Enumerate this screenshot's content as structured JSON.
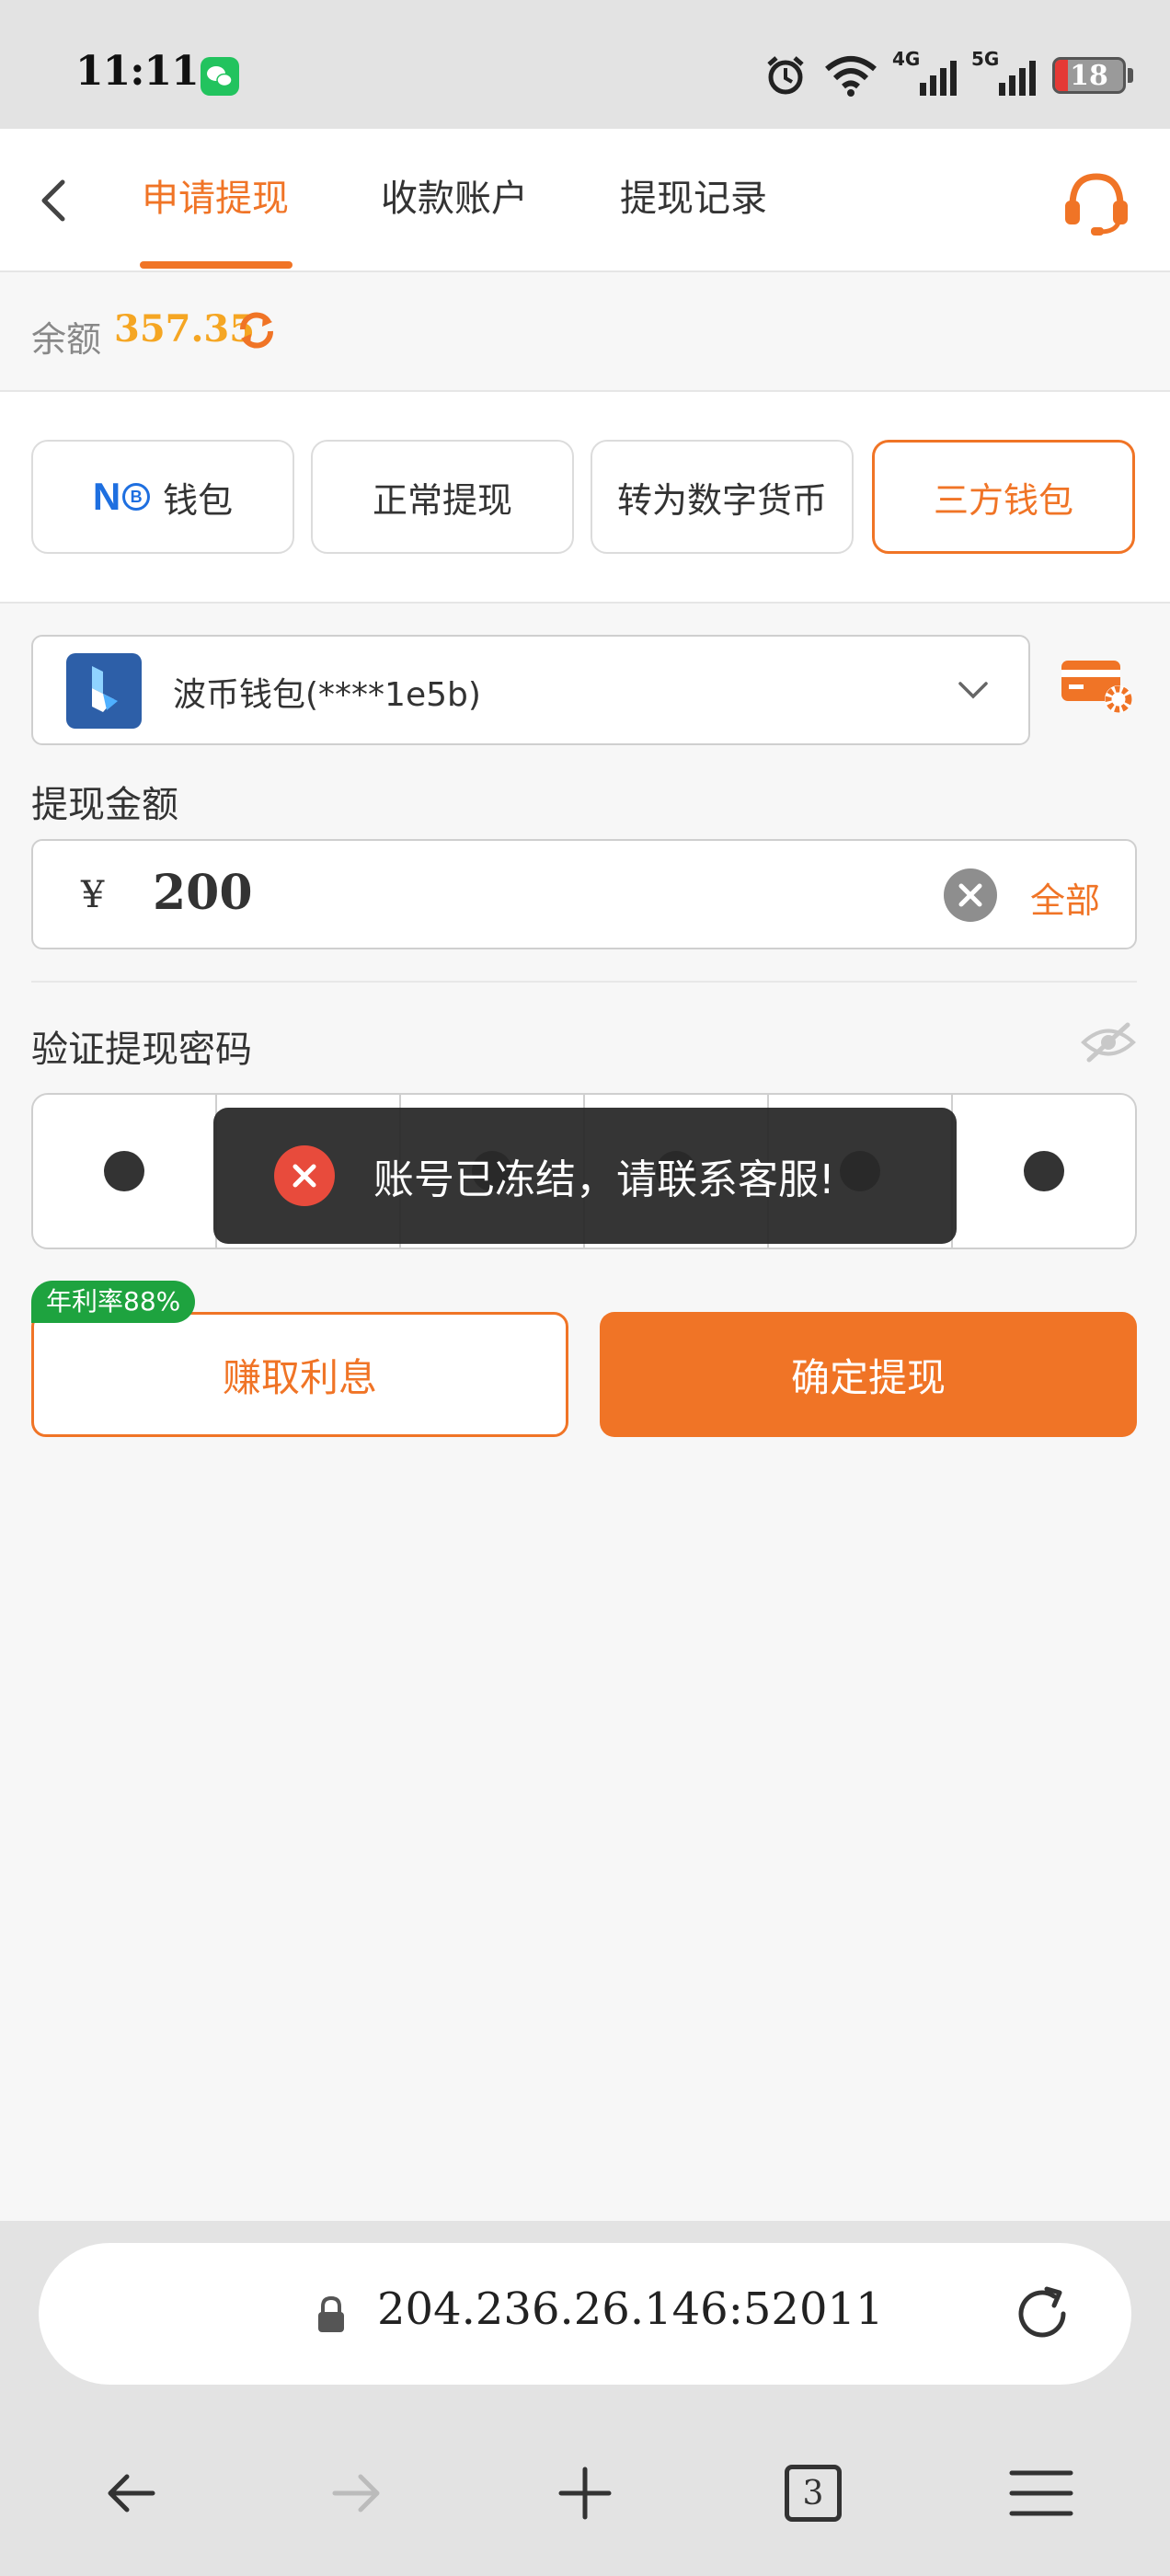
{
  "status_bar": {
    "time": "11:11",
    "network_4g": "4G",
    "network_5g": "5G",
    "battery": "18"
  },
  "nav": {
    "tabs": [
      {
        "label": "申请提现",
        "active": true
      },
      {
        "label": "收款账户",
        "active": false
      },
      {
        "label": "提现记录",
        "active": false
      }
    ]
  },
  "balance": {
    "label": "余额",
    "value": "357.35"
  },
  "methods": [
    {
      "label": "钱包",
      "logo": "NB",
      "active": false
    },
    {
      "label": "正常提现",
      "active": false
    },
    {
      "label": "转为数字货币",
      "active": false
    },
    {
      "label": "三方钱包",
      "active": true
    }
  ],
  "wallet": {
    "selected": "波币钱包(****1e5b)"
  },
  "amount": {
    "title": "提现金额",
    "currency": "¥",
    "value": "200",
    "all_label": "全部"
  },
  "verify": {
    "title": "验证提现密码",
    "digits_entered": 6
  },
  "toast": {
    "message": "账号已冻结，请联系客服!"
  },
  "actions": {
    "rate_tag": "年利率88%",
    "earn_label": "赚取利息",
    "confirm_label": "确定提现"
  },
  "browser": {
    "url": "204.236.26.146:52011",
    "tab_count": "3"
  },
  "colors": {
    "accent": "#f07426",
    "balance": "#f5a623",
    "tag_green": "#1ea33f",
    "error_red": "#e84b3c"
  }
}
